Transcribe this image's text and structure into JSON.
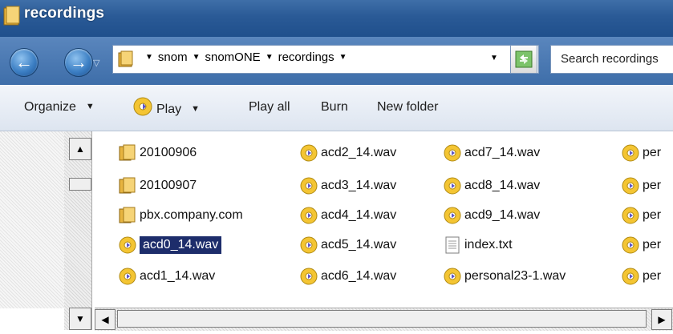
{
  "window": {
    "title": "recordings"
  },
  "address": {
    "crumbs": [
      "snom",
      "snomONE",
      "recordings"
    ],
    "search_placeholder": "Search recordings"
  },
  "toolbar": {
    "organize": "Organize",
    "play": "Play",
    "play_all": "Play all",
    "burn": "Burn",
    "new_folder": "New folder"
  },
  "files": {
    "col1": [
      {
        "name": "20100906",
        "type": "folder"
      },
      {
        "name": "20100907",
        "type": "folder"
      },
      {
        "name": "pbx.company.com",
        "type": "folder"
      },
      {
        "name": "acd0_14.wav",
        "type": "audio",
        "selected": true
      },
      {
        "name": "acd1_14.wav",
        "type": "audio"
      }
    ],
    "col2": [
      {
        "name": "acd2_14.wav",
        "type": "audio"
      },
      {
        "name": "acd3_14.wav",
        "type": "audio"
      },
      {
        "name": "acd4_14.wav",
        "type": "audio"
      },
      {
        "name": "acd5_14.wav",
        "type": "audio"
      },
      {
        "name": "acd6_14.wav",
        "type": "audio"
      }
    ],
    "col3": [
      {
        "name": "acd7_14.wav",
        "type": "audio"
      },
      {
        "name": "acd8_14.wav",
        "type": "audio"
      },
      {
        "name": "acd9_14.wav",
        "type": "audio"
      },
      {
        "name": "index.txt",
        "type": "text"
      },
      {
        "name": "personal23-1.wav",
        "type": "audio"
      }
    ],
    "col4": [
      {
        "name": "per",
        "type": "audio"
      },
      {
        "name": "per",
        "type": "audio"
      },
      {
        "name": "per",
        "type": "audio"
      },
      {
        "name": "per",
        "type": "audio"
      },
      {
        "name": "per",
        "type": "audio"
      }
    ]
  },
  "colors": {
    "titlebar": "#2a5a96",
    "selection": "#1d2d6b"
  }
}
